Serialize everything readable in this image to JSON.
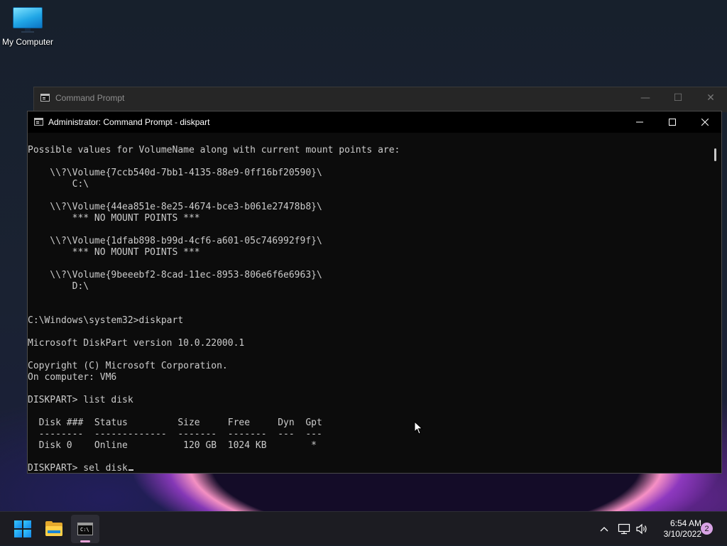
{
  "desktop": {
    "icons": [
      {
        "label": "My Computer",
        "icon": "computer-icon"
      }
    ]
  },
  "background_window": {
    "title": "Command Prompt",
    "controls": {
      "minimize": "—",
      "maximize": "☐",
      "close": "✕"
    }
  },
  "window": {
    "title": "Administrator: Command Prompt - diskpart",
    "controls": {
      "minimize": "minimize-icon",
      "maximize": "maximize-icon",
      "close": "close-icon"
    },
    "console": {
      "lines": [
        "Possible values for VolumeName along with current mount points are:",
        "",
        "    \\\\?\\Volume{7ccb540d-7bb1-4135-88e9-0ff16bf20590}\\",
        "        C:\\",
        "",
        "    \\\\?\\Volume{44ea851e-8e25-4674-bce3-b061e27478b8}\\",
        "        *** NO MOUNT POINTS ***",
        "",
        "    \\\\?\\Volume{1dfab898-b99d-4cf6-a601-05c746992f9f}\\",
        "        *** NO MOUNT POINTS ***",
        "",
        "    \\\\?\\Volume{9beeebf2-8cad-11ec-8953-806e6f6e6963}\\",
        "        D:\\",
        "",
        "",
        "C:\\Windows\\system32>diskpart",
        "",
        "Microsoft DiskPart version 10.0.22000.1",
        "",
        "Copyright (C) Microsoft Corporation.",
        "On computer: VM6",
        "",
        "DISKPART> list disk",
        "",
        "  Disk ###  Status         Size     Free     Dyn  Gpt",
        "  --------  -------------  -------  -------  ---  ---",
        "  Disk 0    Online          120 GB  1024 KB        *",
        ""
      ],
      "prompt_line": "DISKPART> sel disk"
    }
  },
  "taskbar": {
    "apps": [
      {
        "name": "Start",
        "icon": "windows-logo-icon"
      },
      {
        "name": "File Explorer",
        "icon": "folder-icon"
      },
      {
        "name": "Command Prompt",
        "icon": "cmd-icon",
        "active": true
      }
    ],
    "tray": {
      "icons": [
        "chevron-up-icon",
        "network-icon",
        "volume-icon"
      ],
      "time": "6:54 AM",
      "date": "3/10/2022",
      "notification_count": "2"
    }
  },
  "colors": {
    "console_bg": "#0c0c0c",
    "console_fg": "#cccccc",
    "titlebar_bg": "#000000",
    "taskbar_bg": "#1c1c22",
    "accent": "#e8a3d9"
  }
}
